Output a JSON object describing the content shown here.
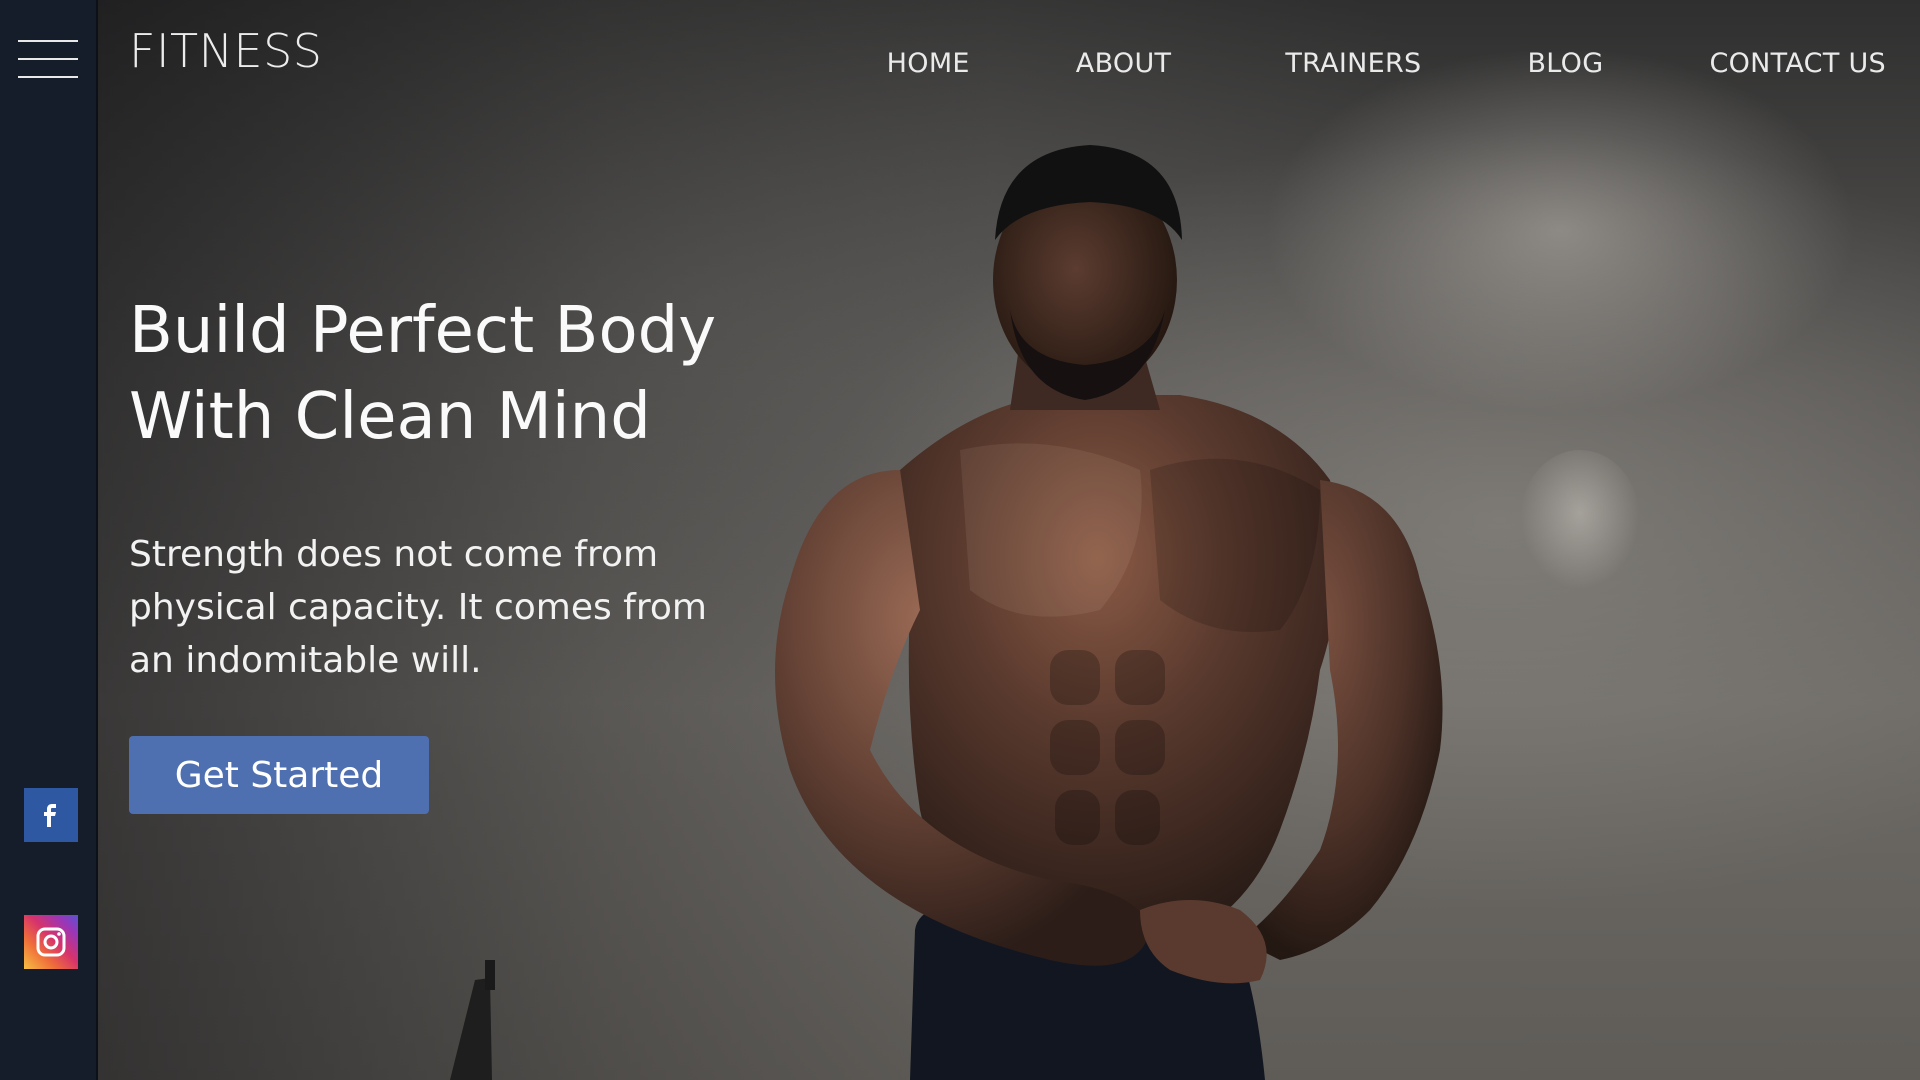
{
  "brand": {
    "logo_text": "FITNESS"
  },
  "nav": {
    "items": [
      {
        "label": "HOME"
      },
      {
        "label": "ABOUT"
      },
      {
        "label": "TRAINERS"
      },
      {
        "label": "BLOG"
      },
      {
        "label": "CONTACT US"
      }
    ]
  },
  "hero": {
    "headline_line1": "Build Perfect Body",
    "headline_line2": "With Clean Mind",
    "subtitle": "Strength does not come from physical capacity. It comes from an indomitable will.",
    "cta_label": "Get Started",
    "image_alt": "Muscular athlete in a dark gym"
  },
  "sidebar": {
    "menu_icon": "hamburger-menu-icon",
    "social": [
      {
        "name": "facebook",
        "icon": "facebook-icon",
        "color": "#2f58a3"
      },
      {
        "name": "instagram",
        "icon": "instagram-icon",
        "color": "#d6336c"
      }
    ]
  },
  "theme": {
    "sidebar_bg": "#151d2a",
    "cta_bg": "#4e6fb0",
    "text": "#fafafa"
  }
}
